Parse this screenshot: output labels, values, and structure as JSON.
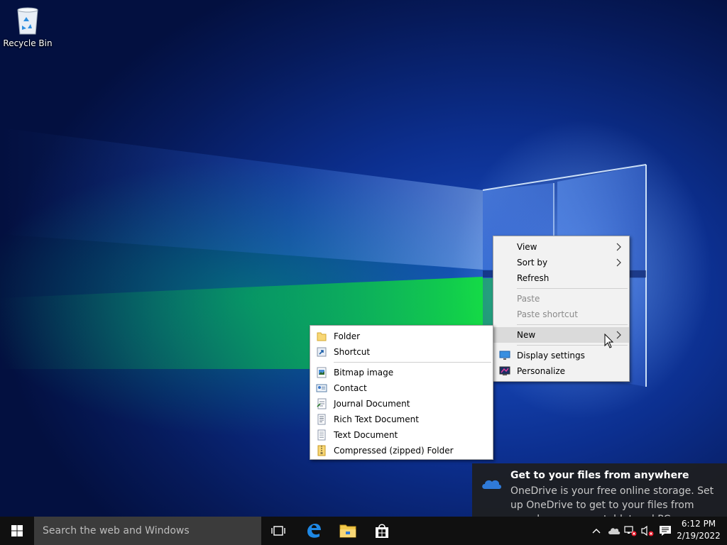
{
  "desktop": {
    "icons": [
      {
        "label": "Recycle Bin",
        "icon": "recycle-bin-icon"
      }
    ]
  },
  "context_menu": {
    "items": [
      {
        "label": "View",
        "submenu": true,
        "enabled": true
      },
      {
        "label": "Sort by",
        "submenu": true,
        "enabled": true
      },
      {
        "label": "Refresh",
        "enabled": true
      },
      {
        "label": "Paste",
        "enabled": false
      },
      {
        "label": "Paste shortcut",
        "enabled": false
      },
      {
        "label": "New",
        "submenu": true,
        "enabled": true,
        "highlighted": true
      },
      {
        "label": "Display settings",
        "icon": "display-icon",
        "enabled": true
      },
      {
        "label": "Personalize",
        "icon": "personalize-icon",
        "enabled": true
      }
    ]
  },
  "new_submenu": {
    "items": [
      {
        "label": "Folder",
        "icon": "folder-icon"
      },
      {
        "label": "Shortcut",
        "icon": "shortcut-icon"
      },
      {
        "label": "Bitmap image",
        "icon": "bitmap-icon"
      },
      {
        "label": "Contact",
        "icon": "contact-icon"
      },
      {
        "label": "Journal Document",
        "icon": "journal-icon"
      },
      {
        "label": "Rich Text Document",
        "icon": "rich-text-icon"
      },
      {
        "label": "Text Document",
        "icon": "text-document-icon"
      },
      {
        "label": "Compressed (zipped) Folder",
        "icon": "zip-folder-icon"
      }
    ]
  },
  "toast": {
    "title": "Get to your files from anywhere",
    "body": "OneDrive is your free online storage. Set up OneDrive to get to your files from anywhere on your tablet and PC."
  },
  "taskbar": {
    "search_placeholder": "Search the web and Windows",
    "time": "6:12 PM",
    "date": "2/19/2022"
  },
  "colors": {
    "taskbar_bg": "#101010",
    "search_bg": "#3b3b3b",
    "menu_bg": "#f2f2f2",
    "menu_hover": "#dadada",
    "disabled_text": "#8a8a8a",
    "accent_blue": "#0078d7"
  }
}
